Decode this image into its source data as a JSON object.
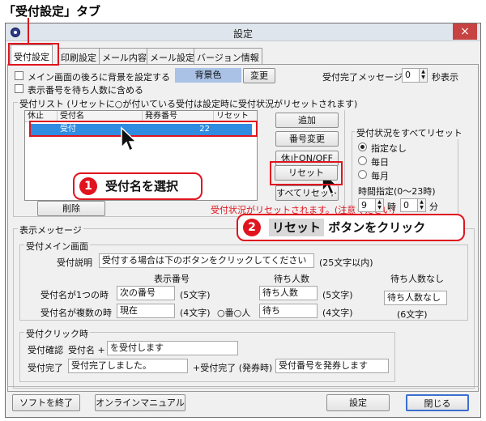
{
  "annotations": {
    "tab_caption": "「受付設定」タブ",
    "callout1_num": "1",
    "callout1_text": "受付名を選択",
    "callout2_num": "2",
    "callout2_text_reset": "リセット",
    "callout2_text_rest": "ボタンをクリック",
    "accent_color": "#e0141e"
  },
  "window": {
    "title": "設定",
    "close_icon": "×"
  },
  "tabs": [
    {
      "label": "受付設定",
      "active": true
    },
    {
      "label": "印刷設定",
      "active": false
    },
    {
      "label": "メール内容",
      "active": false
    },
    {
      "label": "メール設定",
      "active": false
    },
    {
      "label": "バージョン情報",
      "active": false
    }
  ],
  "reception_tab": {
    "bg_option": {
      "label": "メイン画面の後ろに背景を設定する",
      "color_label": "背景色",
      "change_button": "変更"
    },
    "complete_message": {
      "label": "受付完了メッセージ:",
      "value": "0",
      "unit": "秒表示"
    },
    "show_waiting": {
      "label": "表示番号を待ち人数に含める"
    },
    "list_group": {
      "title": "受付リスト (リセットに○が付いている受付は設定時に受付状況がリセットされます)",
      "columns": [
        "休止",
        "受付名",
        "発券番号",
        "リセット"
      ],
      "rows": [
        {
          "pause": "",
          "name": "受付",
          "number": "22",
          "reset": ""
        }
      ],
      "delete_button": "削除",
      "warning": "受付状況がリセットされます。(注意ください)"
    },
    "buttons": {
      "add": "追加",
      "change_number": "番号変更",
      "pause_toggle": "休止ON/OFF",
      "reset": "リセット",
      "reset_all": "すべてリセット"
    },
    "reset_all_group": {
      "title": "受付状況をすべてリセット",
      "options": [
        {
          "label": "指定なし",
          "selected": true
        },
        {
          "label": "毎日",
          "selected": false
        },
        {
          "label": "毎月",
          "selected": false
        }
      ],
      "time_label": "時間指定(0〜23時)",
      "hour_value": "9",
      "hour_unit": "時",
      "minute_value": "0",
      "minute_unit": "分"
    },
    "display_message": {
      "title": "表示メッセージ",
      "main_group": {
        "title": "受付メイン画面",
        "desc_label": "受付説明",
        "desc_value": "受付する場合は下のボタンをクリックしてください",
        "desc_hint": "(25文字以内)",
        "col_display_number": "表示番号",
        "col_waiting": "待ち人数",
        "col_no_waiting": "待ち人数なし",
        "single_label": "受付名が1つの時",
        "single_number": "次の番号",
        "single_number_hint": "(5文字)",
        "single_waiting": "待ち人数",
        "single_waiting_hint": "(5文字)",
        "no_waiting_value": "待ち人数なし",
        "no_waiting_hint": "(6文字)",
        "multi_label": "受付名が複数の時",
        "multi_number": "現在",
        "multi_number_hint": "(4文字)",
        "multi_middle": "○番○人",
        "multi_waiting": "待ち",
        "multi_waiting_hint": "(4文字)"
      },
      "click_group": {
        "title": "受付クリック時",
        "confirm_label": "受付確認",
        "confirm_prefix": "受付名 +",
        "confirm_value": "を受付します",
        "complete_label": "受付完了",
        "complete_value": "受付完了しました。",
        "complete_issue_label": "+受付完了 (発券時)",
        "complete_issue_value": "受付番号を発券します"
      }
    }
  },
  "footer": {
    "exit_button": "ソフトを終了",
    "manual_button": "オンラインマニュアル",
    "settings_button": "設定",
    "close_button": "閉じる"
  }
}
